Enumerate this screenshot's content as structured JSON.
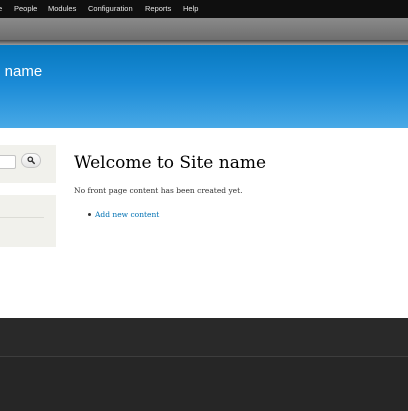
{
  "toolbar": {
    "items": [
      {
        "label": "e"
      },
      {
        "label": "People"
      },
      {
        "label": "Modules"
      },
      {
        "label": "Configuration"
      },
      {
        "label": "Reports"
      },
      {
        "label": "Help"
      }
    ]
  },
  "header": {
    "site_name": "te name"
  },
  "search": {
    "value": "",
    "icon": "magnifier"
  },
  "main": {
    "title": "Welcome to Site name",
    "intro": "No front page content has been created yet.",
    "links": [
      {
        "label": "Add new content"
      }
    ]
  },
  "colors": {
    "header_blue": "#0779bf",
    "link_blue": "#0071b3",
    "toolbar_bg": "#0f0f0f",
    "footer_bg": "#292929"
  }
}
